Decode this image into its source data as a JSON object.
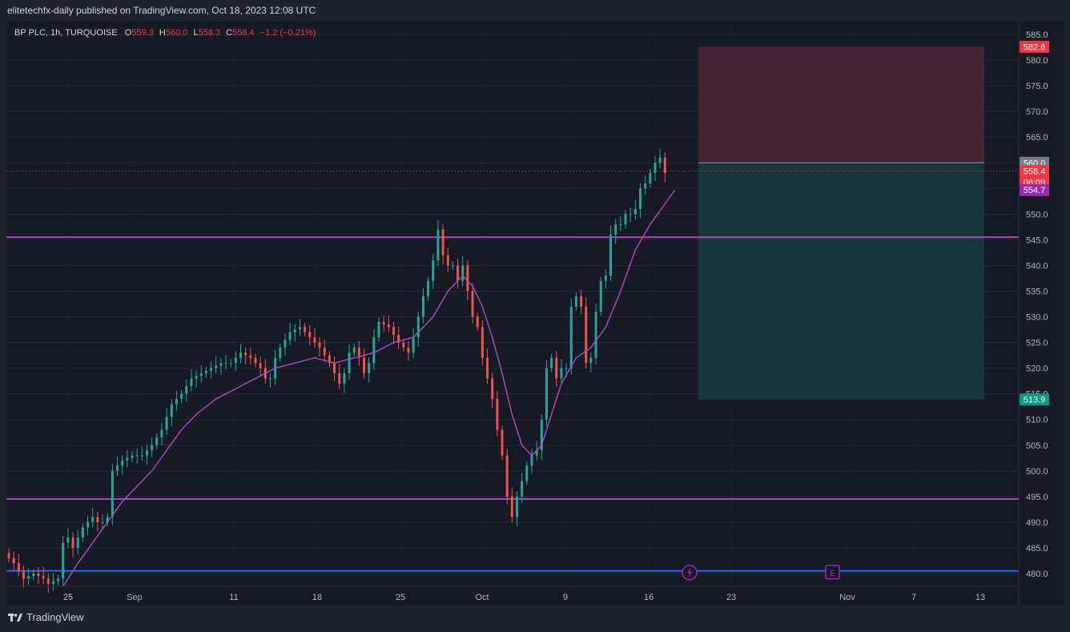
{
  "header": {
    "published_text": "elitetechfx-daily published on TradingView.com, Oct 18, 2023 12:08 UTC"
  },
  "legend": {
    "symbol": "BP PLC, 1h, TURQUOISE",
    "o_label": "O",
    "o_value": "559.3",
    "h_label": "H",
    "h_value": "560.0",
    "l_label": "L",
    "l_value": "558.3",
    "c_label": "C",
    "c_value": "558.4",
    "change": "−1.2 (−0.21%)"
  },
  "brand": {
    "name": "TradingView",
    "logo_icon": "tradingview-logo-icon"
  },
  "colors": {
    "background": "#161a25",
    "up": "#26a69a",
    "down": "#ef5350",
    "ma": "#ab47bc",
    "hline": "#ab47bc",
    "support_line": "#2962ff",
    "stop_zone": "#452532",
    "target_zone": "#17363a"
  },
  "chart_data": {
    "type": "candlestick",
    "symbol": "BP PLC",
    "interval": "1h",
    "exchange": "TURQUOISE",
    "y_range": [
      477.5,
      587.5
    ],
    "y_ticks": [
      "480.0",
      "485.0",
      "490.0",
      "495.0",
      "500.0",
      "505.0",
      "510.0",
      "515.0",
      "520.0",
      "525.0",
      "530.0",
      "535.0",
      "540.0",
      "545.0",
      "550.0",
      "555.0",
      "560.0",
      "565.0",
      "570.0",
      "575.0",
      "580.0",
      "585.0"
    ],
    "x_ticks": [
      "25",
      "Sep",
      "11",
      "18",
      "25",
      "Oct",
      "9",
      "16",
      "23",
      "Nov",
      "7",
      "13"
    ],
    "series": [
      {
        "name": "price",
        "points": [
          [
            0,
            484
          ],
          [
            2,
            482
          ],
          [
            4,
            479
          ],
          [
            6,
            480
          ],
          [
            8,
            479
          ],
          [
            9,
            478
          ],
          [
            10,
            478.5
          ],
          [
            11,
            479
          ],
          [
            12,
            486
          ],
          [
            13,
            487
          ],
          [
            14,
            485
          ],
          [
            15,
            487
          ],
          [
            16,
            489
          ],
          [
            17,
            490
          ],
          [
            18,
            491
          ],
          [
            19,
            490
          ],
          [
            20,
            490
          ],
          [
            21,
            491
          ],
          [
            22,
            500
          ],
          [
            24,
            502
          ],
          [
            26,
            503
          ],
          [
            28,
            503
          ],
          [
            30,
            505
          ],
          [
            32,
            508
          ],
          [
            34,
            513
          ],
          [
            36,
            515
          ],
          [
            38,
            518
          ],
          [
            40,
            519
          ],
          [
            42,
            520
          ],
          [
            44,
            521
          ],
          [
            46,
            521
          ],
          [
            48,
            523
          ],
          [
            50,
            522
          ],
          [
            51,
            521
          ],
          [
            52,
            520
          ],
          [
            53,
            518
          ],
          [
            54,
            518
          ],
          [
            55,
            522
          ],
          [
            56,
            524
          ],
          [
            58,
            527
          ],
          [
            60,
            528
          ],
          [
            62,
            526
          ],
          [
            64,
            524
          ],
          [
            66,
            521
          ],
          [
            67,
            519
          ],
          [
            68,
            517
          ],
          [
            69,
            519
          ],
          [
            70,
            523
          ],
          [
            71,
            524
          ],
          [
            72,
            522
          ],
          [
            73,
            519
          ],
          [
            74,
            521
          ],
          [
            75,
            526
          ],
          [
            76,
            529
          ],
          [
            78,
            528
          ],
          [
            80,
            525
          ],
          [
            81,
            524
          ],
          [
            82,
            523
          ],
          [
            83,
            526
          ],
          [
            84,
            530
          ],
          [
            85,
            534
          ],
          [
            86,
            537
          ],
          [
            87,
            541
          ],
          [
            88,
            547
          ],
          [
            89,
            542
          ],
          [
            90,
            540
          ],
          [
            91,
            540
          ],
          [
            92,
            537
          ],
          [
            93,
            540
          ],
          [
            94,
            535
          ],
          [
            95,
            530
          ],
          [
            96,
            528
          ],
          [
            97,
            522
          ],
          [
            98,
            518
          ],
          [
            99,
            514
          ],
          [
            100,
            508
          ],
          [
            101,
            503
          ],
          [
            102,
            495
          ],
          [
            103,
            491
          ],
          [
            104,
            495
          ],
          [
            105,
            498
          ],
          [
            106,
            501
          ],
          [
            107,
            503
          ],
          [
            108,
            504
          ],
          [
            109,
            510
          ],
          [
            110,
            520
          ],
          [
            111,
            522
          ],
          [
            112,
            518
          ],
          [
            113,
            520
          ],
          [
            114,
            520
          ],
          [
            115,
            532
          ],
          [
            116,
            534
          ],
          [
            117,
            532
          ],
          [
            118,
            521
          ],
          [
            119,
            522
          ],
          [
            120,
            531
          ],
          [
            121,
            537
          ],
          [
            122,
            538
          ],
          [
            123,
            546
          ],
          [
            124,
            548
          ],
          [
            125,
            548
          ],
          [
            126,
            550
          ],
          [
            127,
            550
          ],
          [
            128,
            551
          ],
          [
            129,
            555
          ],
          [
            130,
            556
          ],
          [
            131,
            558
          ],
          [
            132,
            560
          ],
          [
            133,
            561
          ],
          [
            134,
            558
          ]
        ]
      },
      {
        "name": "moving-average",
        "points": [
          [
            11,
            477.5
          ],
          [
            14,
            482
          ],
          [
            17,
            486
          ],
          [
            20,
            490
          ],
          [
            23,
            494
          ],
          [
            26,
            497
          ],
          [
            29,
            500
          ],
          [
            32,
            504
          ],
          [
            35,
            508
          ],
          [
            38,
            511
          ],
          [
            42,
            514
          ],
          [
            46,
            516
          ],
          [
            50,
            518
          ],
          [
            54,
            520
          ],
          [
            58,
            521
          ],
          [
            62,
            522
          ],
          [
            66,
            521
          ],
          [
            70,
            522
          ],
          [
            74,
            523
          ],
          [
            78,
            525
          ],
          [
            82,
            526
          ],
          [
            86,
            530
          ],
          [
            89,
            535
          ],
          [
            92,
            538
          ],
          [
            94,
            536
          ],
          [
            96,
            532
          ],
          [
            98,
            526
          ],
          [
            100,
            519
          ],
          [
            102,
            511
          ],
          [
            104,
            505
          ],
          [
            106,
            503
          ],
          [
            108,
            505
          ],
          [
            110,
            511
          ],
          [
            112,
            517
          ],
          [
            115,
            522
          ],
          [
            118,
            524
          ],
          [
            121,
            528
          ],
          [
            124,
            535
          ],
          [
            127,
            543
          ],
          [
            130,
            548
          ],
          [
            133,
            552
          ],
          [
            135,
            554.7
          ]
        ]
      }
    ],
    "horizontal_lines": [
      {
        "name": "resistance",
        "value": 545.5
      },
      {
        "name": "support",
        "value": 494.5
      },
      {
        "name": "base",
        "value": 480.5
      }
    ],
    "position_tool": {
      "type": "short",
      "entry": 560.0,
      "stop": 582.6,
      "target": 513.9
    },
    "price_labels": [
      {
        "name": "stop",
        "text": "582.6",
        "value": 582.6,
        "color": "#f23645"
      },
      {
        "name": "entry",
        "text": "560.0",
        "value": 560.0,
        "color": "#787b86"
      },
      {
        "name": "last",
        "text": "558.4",
        "value": 558.4,
        "color": "#f23645"
      },
      {
        "name": "countdown",
        "text": "06:09",
        "value": 556.2,
        "color": "#f23645"
      },
      {
        "name": "ma",
        "text": "554.7",
        "value": 554.7,
        "color": "#9c27b0"
      },
      {
        "name": "target",
        "text": "513.9",
        "value": 513.9,
        "color": "#089981"
      }
    ]
  }
}
